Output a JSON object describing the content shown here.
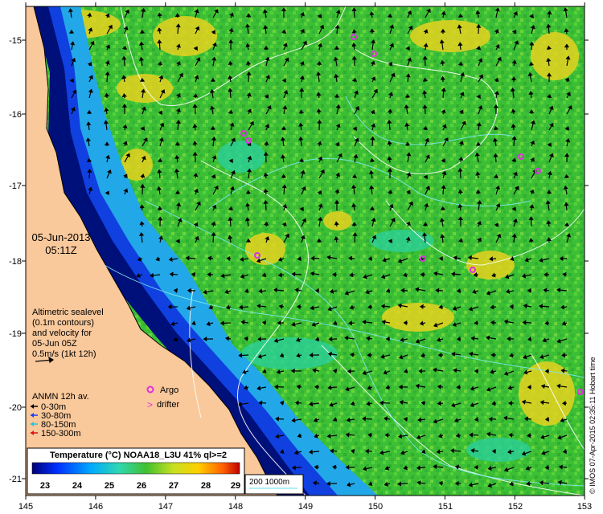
{
  "date_label": "05-Jun-2013",
  "time_label": "05:11Z",
  "altimetry_note": [
    "Altimetric sealevel",
    "(0.1m contours)",
    "and velocity for",
    "05-Jun 05Z",
    "0.5m/s (1kt 12h)"
  ],
  "legend": {
    "argo": "Argo",
    "drifter": "drifter",
    "anmn_title": "ANMN 12h av.",
    "depths": [
      {
        "label": "0-30m",
        "color": "#000000"
      },
      {
        "label": "30-80m",
        "color": "#1a3cff"
      },
      {
        "label": "80-150m",
        "color": "#19c8e6"
      },
      {
        "label": "150-300m",
        "color": "#e01010"
      }
    ]
  },
  "colorbar": {
    "title": "Temperature (°C) NOAA18_L3U 41% ql>=2",
    "ticks": [
      "23",
      "24",
      "25",
      "26",
      "27",
      "28",
      "29"
    ]
  },
  "isobaths": "200  1000m",
  "credit": "© IMOS 07-Apr-2015 02:35:11 Hobart time",
  "lon_ticks": [
    "145",
    "146",
    "147",
    "148",
    "149",
    "150",
    "151",
    "152",
    "153"
  ],
  "lat_ticks": [
    "-15",
    "-16",
    "-17",
    "-18",
    "-19",
    "-20",
    "-21"
  ],
  "colors": {
    "land": "#f9c89b",
    "sea_warm": "#3fc23a",
    "deep_coast": "#00108a",
    "contour": "#ffffff",
    "isobath": "#7de8ee",
    "argo": "#e030e0"
  }
}
